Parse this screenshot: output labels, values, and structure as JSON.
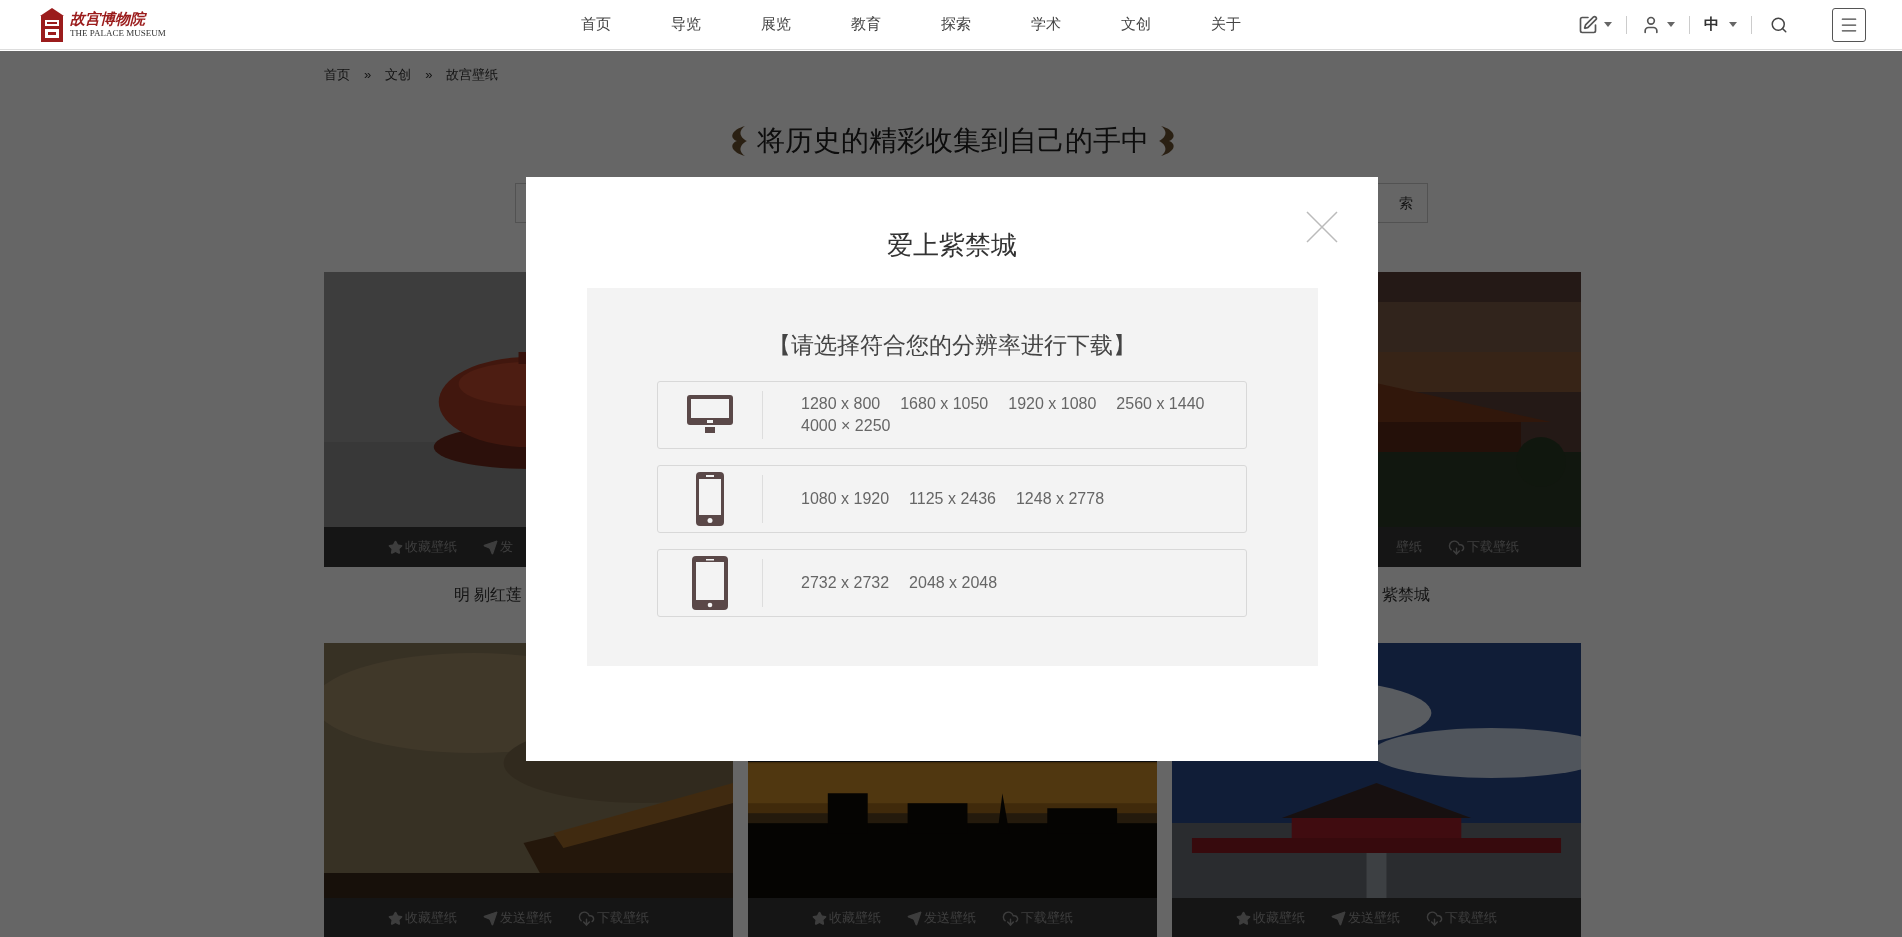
{
  "header": {
    "logo": {
      "name": "故宫博物院",
      "subtitle": "THE PALACE MUSEUM"
    },
    "nav": [
      {
        "label": "首页"
      },
      {
        "label": "导览"
      },
      {
        "label": "展览"
      },
      {
        "label": "教育"
      },
      {
        "label": "探索"
      },
      {
        "label": "学术"
      },
      {
        "label": "文创"
      },
      {
        "label": "关于"
      }
    ],
    "language": "中"
  },
  "breadcrumb": {
    "items": [
      "首页",
      "文创",
      "故宫壁纸"
    ],
    "separators": [
      "»",
      "»"
    ]
  },
  "heading": "将历史的精彩收集到自己的手中",
  "search": {
    "button": "索"
  },
  "rows": [
    {
      "cards": [
        {
          "caption": "明 剔红莲",
          "actions": [
            {
              "kind": "favorite",
              "label": "收藏壁纸"
            },
            {
              "kind": "send",
              "label": "发"
            }
          ]
        },
        {
          "caption": "紫禁城",
          "actions": [
            {
              "kind": "text",
              "label": "壁纸"
            },
            {
              "kind": "download",
              "label": "下载壁纸"
            }
          ]
        }
      ]
    },
    {
      "cards": [
        {
          "actions": [
            {
              "kind": "favorite",
              "label": "收藏壁纸"
            },
            {
              "kind": "send",
              "label": "发送壁纸"
            },
            {
              "kind": "download",
              "label": "下载壁纸"
            }
          ]
        },
        {
          "actions": [
            {
              "kind": "favorite",
              "label": "收藏壁纸"
            },
            {
              "kind": "send",
              "label": "发送壁纸"
            },
            {
              "kind": "download",
              "label": "下载壁纸"
            }
          ]
        },
        {
          "actions": [
            {
              "kind": "favorite",
              "label": "收藏壁纸"
            },
            {
              "kind": "send",
              "label": "发送壁纸"
            },
            {
              "kind": "download",
              "label": "下载壁纸"
            }
          ]
        }
      ]
    }
  ],
  "modal": {
    "title": "爱上紫禁城",
    "panel_heading": "【请选择符合您的分辨率进行下载】",
    "resolutions": [
      {
        "kind": "desktop",
        "options": [
          "1280 x 800",
          "1680 x 1050",
          "1920 x 1080",
          "2560 x 1440",
          "4000 × 2250"
        ]
      },
      {
        "kind": "phone",
        "options": [
          "1080 x 1920",
          "1125 x 2436",
          "1248 x 2778"
        ]
      },
      {
        "kind": "tablet",
        "options": [
          "2732 x 2732",
          "2048 x 2048"
        ]
      }
    ]
  }
}
